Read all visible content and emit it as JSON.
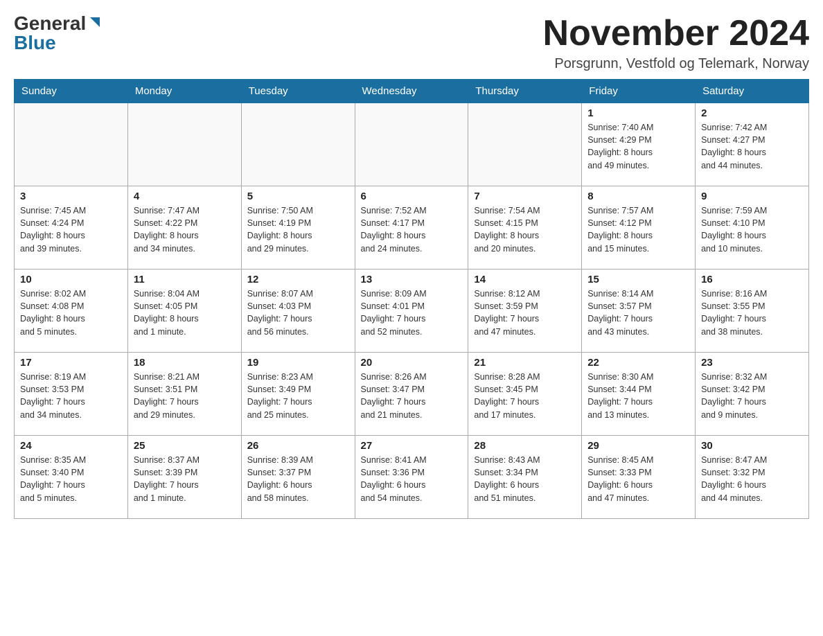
{
  "header": {
    "logo_general": "General",
    "logo_blue": "Blue",
    "month_title": "November 2024",
    "location": "Porsgrunn, Vestfold og Telemark, Norway"
  },
  "weekdays": [
    "Sunday",
    "Monday",
    "Tuesday",
    "Wednesday",
    "Thursday",
    "Friday",
    "Saturday"
  ],
  "weeks": [
    [
      {
        "day": "",
        "info": ""
      },
      {
        "day": "",
        "info": ""
      },
      {
        "day": "",
        "info": ""
      },
      {
        "day": "",
        "info": ""
      },
      {
        "day": "",
        "info": ""
      },
      {
        "day": "1",
        "info": "Sunrise: 7:40 AM\nSunset: 4:29 PM\nDaylight: 8 hours\nand 49 minutes."
      },
      {
        "day": "2",
        "info": "Sunrise: 7:42 AM\nSunset: 4:27 PM\nDaylight: 8 hours\nand 44 minutes."
      }
    ],
    [
      {
        "day": "3",
        "info": "Sunrise: 7:45 AM\nSunset: 4:24 PM\nDaylight: 8 hours\nand 39 minutes."
      },
      {
        "day": "4",
        "info": "Sunrise: 7:47 AM\nSunset: 4:22 PM\nDaylight: 8 hours\nand 34 minutes."
      },
      {
        "day": "5",
        "info": "Sunrise: 7:50 AM\nSunset: 4:19 PM\nDaylight: 8 hours\nand 29 minutes."
      },
      {
        "day": "6",
        "info": "Sunrise: 7:52 AM\nSunset: 4:17 PM\nDaylight: 8 hours\nand 24 minutes."
      },
      {
        "day": "7",
        "info": "Sunrise: 7:54 AM\nSunset: 4:15 PM\nDaylight: 8 hours\nand 20 minutes."
      },
      {
        "day": "8",
        "info": "Sunrise: 7:57 AM\nSunset: 4:12 PM\nDaylight: 8 hours\nand 15 minutes."
      },
      {
        "day": "9",
        "info": "Sunrise: 7:59 AM\nSunset: 4:10 PM\nDaylight: 8 hours\nand 10 minutes."
      }
    ],
    [
      {
        "day": "10",
        "info": "Sunrise: 8:02 AM\nSunset: 4:08 PM\nDaylight: 8 hours\nand 5 minutes."
      },
      {
        "day": "11",
        "info": "Sunrise: 8:04 AM\nSunset: 4:05 PM\nDaylight: 8 hours\nand 1 minute."
      },
      {
        "day": "12",
        "info": "Sunrise: 8:07 AM\nSunset: 4:03 PM\nDaylight: 7 hours\nand 56 minutes."
      },
      {
        "day": "13",
        "info": "Sunrise: 8:09 AM\nSunset: 4:01 PM\nDaylight: 7 hours\nand 52 minutes."
      },
      {
        "day": "14",
        "info": "Sunrise: 8:12 AM\nSunset: 3:59 PM\nDaylight: 7 hours\nand 47 minutes."
      },
      {
        "day": "15",
        "info": "Sunrise: 8:14 AM\nSunset: 3:57 PM\nDaylight: 7 hours\nand 43 minutes."
      },
      {
        "day": "16",
        "info": "Sunrise: 8:16 AM\nSunset: 3:55 PM\nDaylight: 7 hours\nand 38 minutes."
      }
    ],
    [
      {
        "day": "17",
        "info": "Sunrise: 8:19 AM\nSunset: 3:53 PM\nDaylight: 7 hours\nand 34 minutes."
      },
      {
        "day": "18",
        "info": "Sunrise: 8:21 AM\nSunset: 3:51 PM\nDaylight: 7 hours\nand 29 minutes."
      },
      {
        "day": "19",
        "info": "Sunrise: 8:23 AM\nSunset: 3:49 PM\nDaylight: 7 hours\nand 25 minutes."
      },
      {
        "day": "20",
        "info": "Sunrise: 8:26 AM\nSunset: 3:47 PM\nDaylight: 7 hours\nand 21 minutes."
      },
      {
        "day": "21",
        "info": "Sunrise: 8:28 AM\nSunset: 3:45 PM\nDaylight: 7 hours\nand 17 minutes."
      },
      {
        "day": "22",
        "info": "Sunrise: 8:30 AM\nSunset: 3:44 PM\nDaylight: 7 hours\nand 13 minutes."
      },
      {
        "day": "23",
        "info": "Sunrise: 8:32 AM\nSunset: 3:42 PM\nDaylight: 7 hours\nand 9 minutes."
      }
    ],
    [
      {
        "day": "24",
        "info": "Sunrise: 8:35 AM\nSunset: 3:40 PM\nDaylight: 7 hours\nand 5 minutes."
      },
      {
        "day": "25",
        "info": "Sunrise: 8:37 AM\nSunset: 3:39 PM\nDaylight: 7 hours\nand 1 minute."
      },
      {
        "day": "26",
        "info": "Sunrise: 8:39 AM\nSunset: 3:37 PM\nDaylight: 6 hours\nand 58 minutes."
      },
      {
        "day": "27",
        "info": "Sunrise: 8:41 AM\nSunset: 3:36 PM\nDaylight: 6 hours\nand 54 minutes."
      },
      {
        "day": "28",
        "info": "Sunrise: 8:43 AM\nSunset: 3:34 PM\nDaylight: 6 hours\nand 51 minutes."
      },
      {
        "day": "29",
        "info": "Sunrise: 8:45 AM\nSunset: 3:33 PM\nDaylight: 6 hours\nand 47 minutes."
      },
      {
        "day": "30",
        "info": "Sunrise: 8:47 AM\nSunset: 3:32 PM\nDaylight: 6 hours\nand 44 minutes."
      }
    ]
  ]
}
